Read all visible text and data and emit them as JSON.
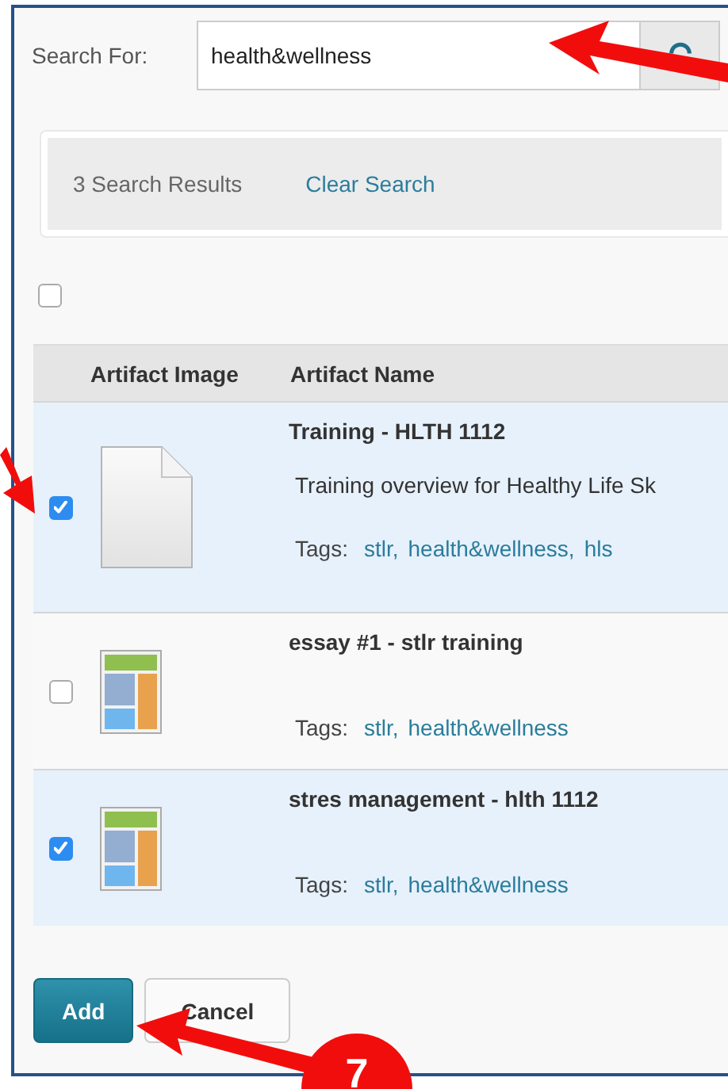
{
  "search": {
    "label": "Search For:",
    "value": "health&wellness"
  },
  "results": {
    "count": "3 Search Results",
    "clear_link": "Clear Search"
  },
  "select_all": {
    "checked": false
  },
  "table": {
    "columns": [
      "Artifact Image",
      "Artifact Name"
    ],
    "rows": [
      {
        "checked": true,
        "kind": "document",
        "name": "Training - HLTH 1112",
        "description": "Training overview for Healthy Life Sk",
        "tags_label": "Tags:",
        "tags": [
          "stlr,",
          "health&wellness,",
          "hls"
        ]
      },
      {
        "checked": false,
        "kind": "layout",
        "name": "essay #1 - stlr training",
        "tags_label": "Tags:",
        "tags": [
          "stlr,",
          "health&wellness"
        ]
      },
      {
        "checked": true,
        "kind": "layout",
        "name": "stres management - hlth 1112",
        "tags_label": "Tags:",
        "tags": [
          "stlr,",
          "health&wellness"
        ]
      }
    ]
  },
  "buttons": [
    {
      "kind": "primary",
      "label": "Add"
    },
    {
      "kind": "secondary",
      "label": "Cancel"
    }
  ],
  "annotation": {
    "step": "7"
  }
}
